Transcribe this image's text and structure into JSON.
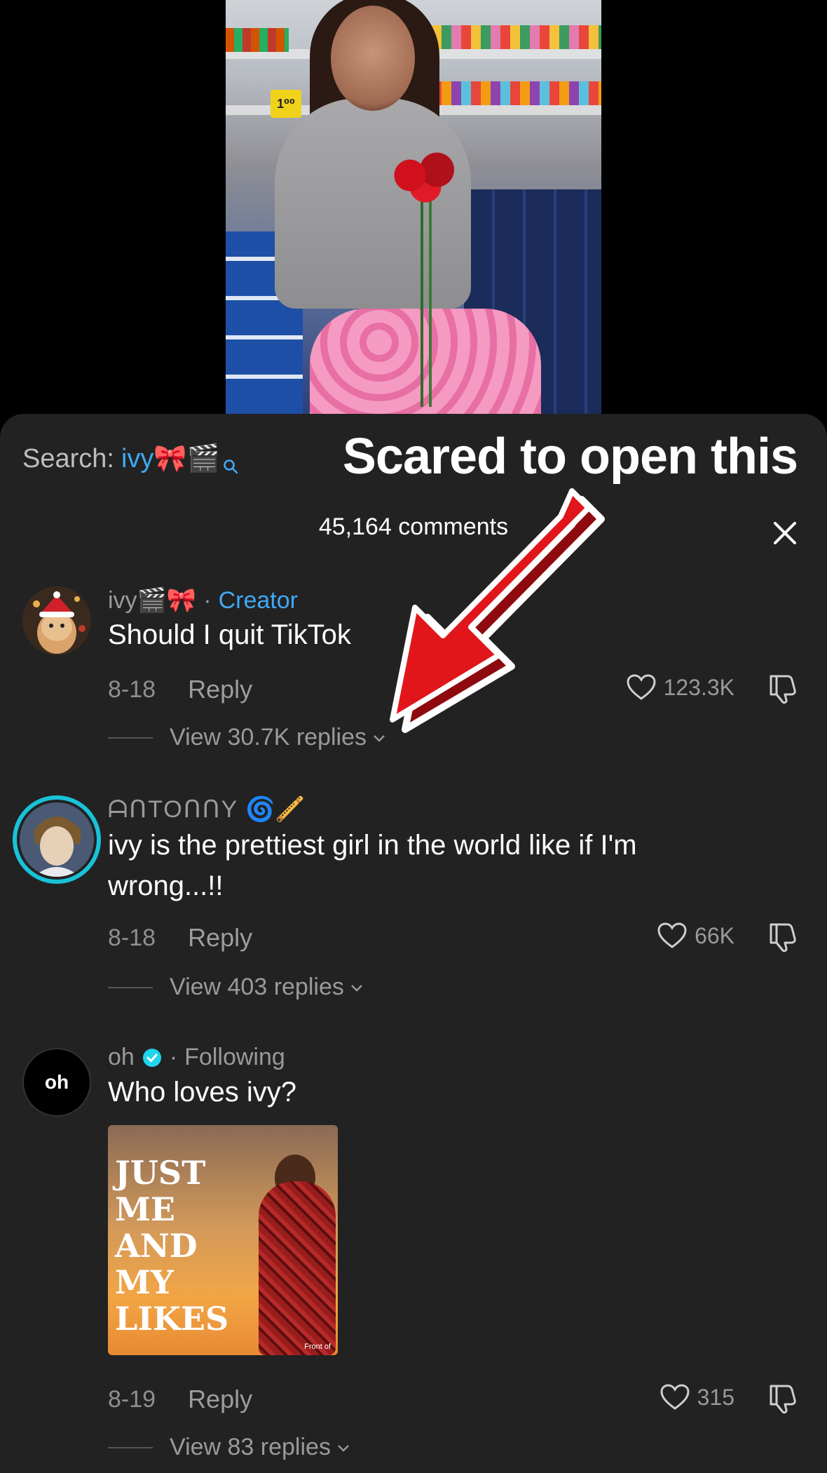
{
  "video": {
    "price_tag": "1⁰⁰"
  },
  "search": {
    "prefix": "Search:",
    "term": "ivy🎀🎬"
  },
  "overlay_title": "Scared to open this",
  "comments_header": {
    "count_label": "45,164 comments"
  },
  "comments": [
    {
      "username": "ivy🎬🎀",
      "separator": "·",
      "badge": "Creator",
      "text": "Should I quit TikTok",
      "date": "8-18",
      "reply_label": "Reply",
      "likes": "123.3K",
      "view_replies": "View 30.7K replies"
    },
    {
      "username": "ᗩᑎTOᑎᑎY",
      "username_emoji": "🌀🪈",
      "text": "ivy is the prettiest girl in the world like if I'm wrong...!!",
      "date": "8-18",
      "reply_label": "Reply",
      "likes": "66K",
      "view_replies": "View 403 replies"
    },
    {
      "avatar_label": "oh",
      "username": "oh",
      "separator": "·",
      "status": "Following",
      "text": "Who loves ivy?",
      "media_caption": "JUST ME AND MY LIKES",
      "media_credit": "Front of",
      "date": "8-19",
      "reply_label": "Reply",
      "likes": "315",
      "view_replies": "View 83 replies"
    }
  ],
  "colors": {
    "sheet_bg": "#222222",
    "accent_blue": "#3fa9f5",
    "muted_text": "#9a9a9a",
    "arrow_red": "#e0161b"
  }
}
